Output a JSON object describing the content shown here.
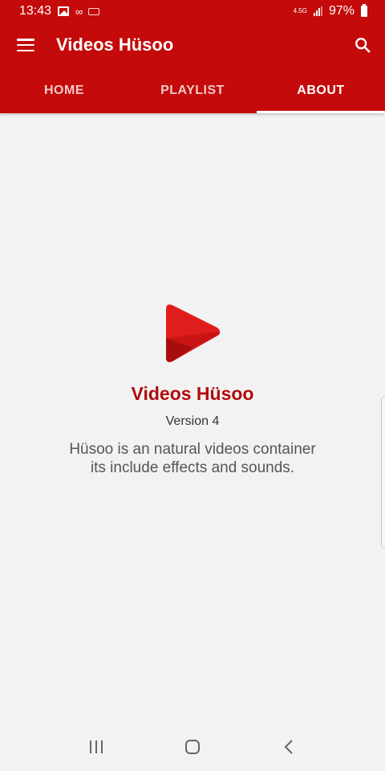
{
  "status_bar": {
    "time": "13:43",
    "network": "4.5G",
    "battery": "97%"
  },
  "app_bar": {
    "title": "Videos Hüsoo"
  },
  "tabs": [
    {
      "label": "HOME",
      "active": false
    },
    {
      "label": "PLAYLIST",
      "active": false
    },
    {
      "label": "ABOUT",
      "active": true
    }
  ],
  "about": {
    "app_name": "Videos Hüsoo",
    "version": "Version 4",
    "description": "Hüsoo is an natural videos container its include effects and sounds."
  },
  "colors": {
    "primary": "#c40a0a",
    "title_red": "#b10c0c",
    "background": "#f2f2f2"
  },
  "icons": {
    "menu": "hamburger-menu-icon",
    "search": "search-icon",
    "logo": "play-logo-icon",
    "nav_recents": "recents-icon",
    "nav_home": "home-icon",
    "nav_back": "back-icon"
  }
}
